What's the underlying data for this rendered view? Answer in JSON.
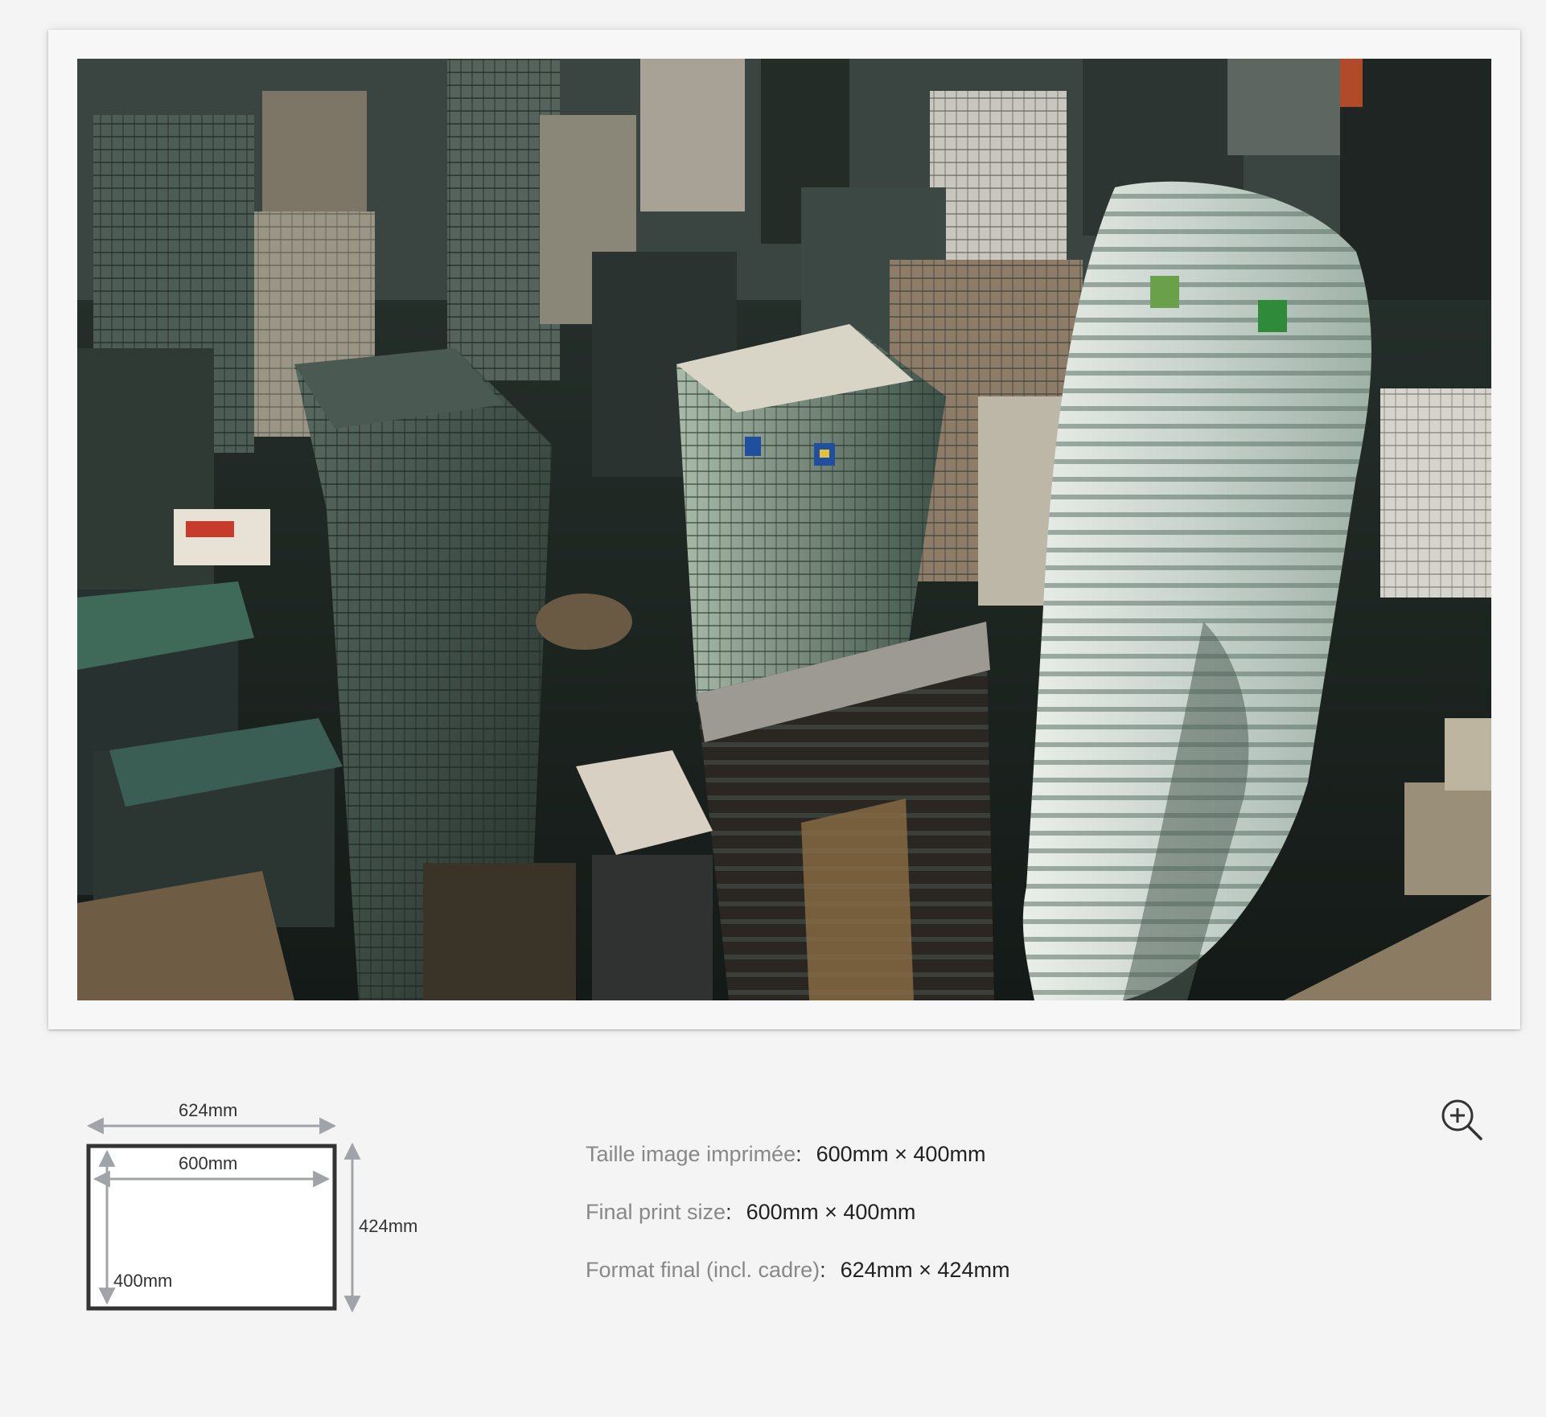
{
  "print": {
    "image_alt": "Aerial view of downtown skyscrapers with TD and RBC towers"
  },
  "diagram": {
    "outer_width": "624mm",
    "inner_width": "600mm",
    "outer_height": "424mm",
    "inner_height": "400mm"
  },
  "info": [
    {
      "label": "Taille image imprimée",
      "sep": ":",
      "value": "600mm × 400mm"
    },
    {
      "label": "Final print size",
      "sep": ":",
      "value": "600mm × 400mm"
    },
    {
      "label": "Format final (incl. cadre)",
      "sep": ":",
      "value": "624mm × 424mm"
    }
  ],
  "icons": {
    "zoom": "zoom-in-icon"
  },
  "colors": {
    "background": "#f4f4f4",
    "frame": "#f7f7f7",
    "diagram_border": "#333333",
    "dimension_lines": "#a0a4a8",
    "label_grey": "#888888",
    "value_dark": "#222222"
  }
}
